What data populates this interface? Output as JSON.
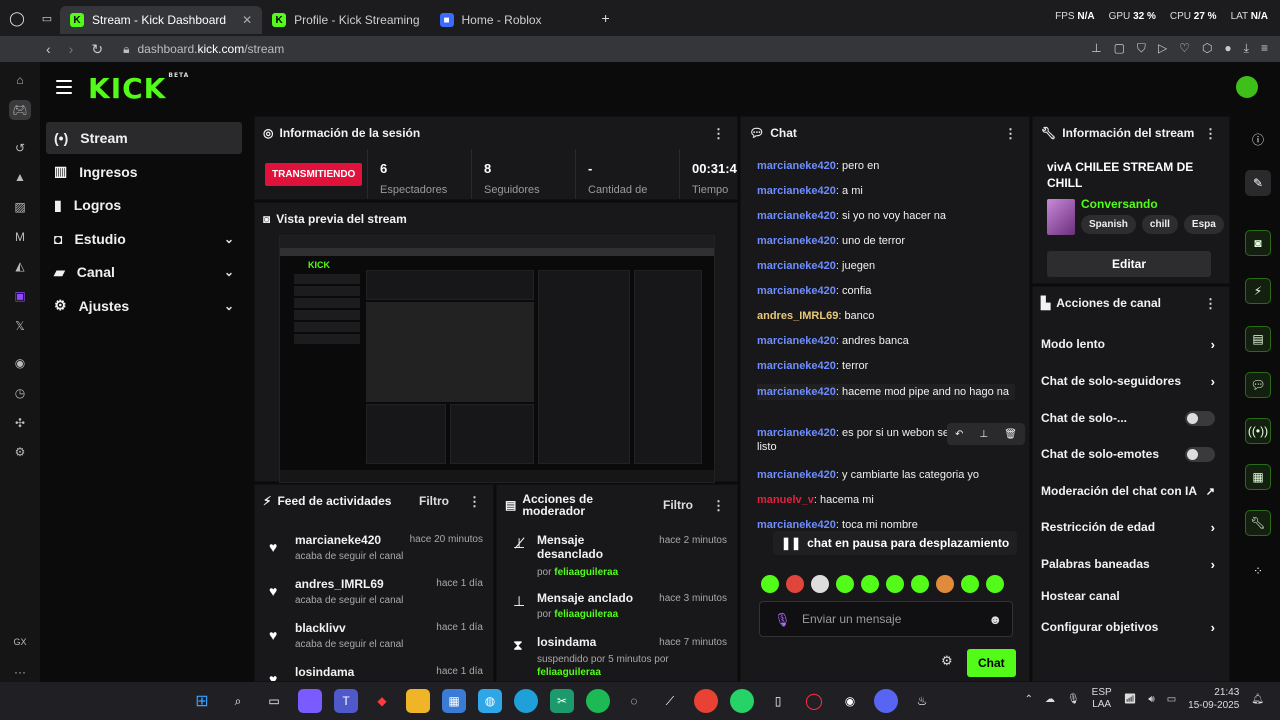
{
  "browser": {
    "tabs": [
      {
        "label": "Stream - Kick Dashboard",
        "active": true
      },
      {
        "label": "Profile - Kick Streaming",
        "active": false
      },
      {
        "label": "Home - Roblox",
        "active": false
      }
    ],
    "hud": {
      "fps_label": "FPS",
      "fps": "N/A",
      "gpu_label": "GPU",
      "gpu": "32 %",
      "cpu_label": "CPU",
      "cpu": "27 %",
      "lat_label": "LAT",
      "lat": "N/A"
    },
    "url": {
      "host": "dashboard.",
      "domain": "kick.com",
      "path": "/stream"
    }
  },
  "app": {
    "logo": "KICK",
    "logo_badge": "BETA"
  },
  "sidebar": {
    "items": [
      {
        "label": "Stream",
        "icon": "stream-icon",
        "selected": true
      },
      {
        "label": "Ingresos",
        "icon": "chart-icon"
      },
      {
        "label": "Logros",
        "icon": "trophy-icon"
      },
      {
        "label": "Estudio",
        "icon": "camera-icon",
        "expandable": true
      },
      {
        "label": "Canal",
        "icon": "channel-icon",
        "expandable": true
      },
      {
        "label": "Ajustes",
        "icon": "gear-icon",
        "expandable": true
      }
    ]
  },
  "session": {
    "title": "Información de la sesión",
    "live_label": "TRANSMITIENDO",
    "stats": [
      {
        "value": "6",
        "label": "Espectadores"
      },
      {
        "value": "8",
        "label": "Seguidores"
      },
      {
        "value": "-",
        "label": "Cantidad de"
      },
      {
        "value": "00:31:4",
        "label": "Tiempo"
      }
    ]
  },
  "preview": {
    "title": "Vista previa del stream"
  },
  "feed": {
    "title": "Feed de actividades",
    "filter": "Filtro",
    "items": [
      {
        "user": "marcianeke420",
        "action": "acaba de seguir el canal",
        "time": "hace 20 minutos"
      },
      {
        "user": "andres_IMRL69",
        "action": "acaba de seguir el canal",
        "time": "hace 1 día"
      },
      {
        "user": "blacklivv",
        "action": "acaba de seguir el canal",
        "time": "hace 1 día"
      },
      {
        "user": "losindama",
        "action": "",
        "time": "hace 1 día"
      }
    ]
  },
  "modactions": {
    "title": "Acciones de moderador",
    "filter": "Filtro",
    "items": [
      {
        "title": "Mensaje desanclado",
        "by_prefix": "por",
        "by": "feliaaguileraa",
        "time": "hace 2 minutos"
      },
      {
        "title": "Mensaje anclado",
        "by_prefix": "por",
        "by": "feliaaguileraa",
        "time": "hace 3 minutos"
      },
      {
        "title": "losindama",
        "by_prefix": "suspendido por 5 minutos por",
        "by": "feliaaguileraa",
        "time": "hace 7 minutos"
      }
    ]
  },
  "chat": {
    "title": "Chat",
    "messages": [
      {
        "user": "marcianeke420",
        "text": "pero en",
        "color": "#6e8dff"
      },
      {
        "user": "marcianeke420",
        "text": "a mi",
        "color": "#6e8dff"
      },
      {
        "user": "marcianeke420",
        "text": "si yo no voy hacer na",
        "color": "#6e8dff"
      },
      {
        "user": "marcianeke420",
        "text": "uno de terror",
        "color": "#6e8dff"
      },
      {
        "user": "marcianeke420",
        "text": "juegen",
        "color": "#6e8dff"
      },
      {
        "user": "marcianeke420",
        "text": "confia",
        "color": "#6e8dff"
      },
      {
        "user": "andres_IMRL69",
        "text": "banco",
        "color": "#e8c87a"
      },
      {
        "user": "marcianeke420",
        "text": "andres banca",
        "color": "#6e8dff"
      },
      {
        "user": "marcianeke420",
        "text": "terror",
        "color": "#6e8dff"
      },
      {
        "user": "marcianeke420",
        "text": "haceme mod pipe and no hago na",
        "color": "#6e8dff"
      },
      {
        "user": "marcianeke420",
        "text": "es por si un webon se pasa de listo",
        "color": "#6e8dff"
      },
      {
        "user": "marcianeke420",
        "text": "y cambiarte las categoria yo",
        "color": "#6e8dff"
      },
      {
        "user": "manuelv_v",
        "text": "hacema mi",
        "color": "#e0203e"
      },
      {
        "user": "marcianeke420",
        "text": "toca mi nombre",
        "color": "#6e8dff"
      }
    ],
    "paused_label": "chat en pausa para desplazamiento",
    "input_placeholder": "Enviar un mensaje",
    "send_label": "Chat"
  },
  "streaminfo": {
    "title": "Información del stream",
    "stream_title": "vivA CHILEE STREAM DE CHILL",
    "category": "Conversando",
    "tags": [
      "Spanish",
      "chill",
      "Espa"
    ],
    "edit_label": "Editar"
  },
  "channelactions": {
    "title": "Acciones de canal",
    "items": [
      {
        "label": "Modo lento",
        "kind": "arrow"
      },
      {
        "label": "Chat de solo-seguidores",
        "kind": "arrow"
      },
      {
        "label": "Chat de solo-...",
        "kind": "toggle"
      },
      {
        "label": "Chat de solo-emotes",
        "kind": "toggle"
      },
      {
        "label": "Moderación del chat con IA",
        "kind": "external"
      },
      {
        "label": "Restricción de edad",
        "kind": "arrow"
      },
      {
        "label": "Palabras baneadas",
        "kind": "arrow"
      },
      {
        "label": "Hostear canal",
        "kind": "none"
      },
      {
        "label": "Configurar objetivos",
        "kind": "arrow"
      }
    ]
  },
  "taskbar": {
    "lang": "ESP",
    "lang2": "LAA",
    "time": "21:43",
    "date": "15-09-2025"
  },
  "colors": {
    "accent": "#53fc18",
    "live": "#e0123b"
  }
}
